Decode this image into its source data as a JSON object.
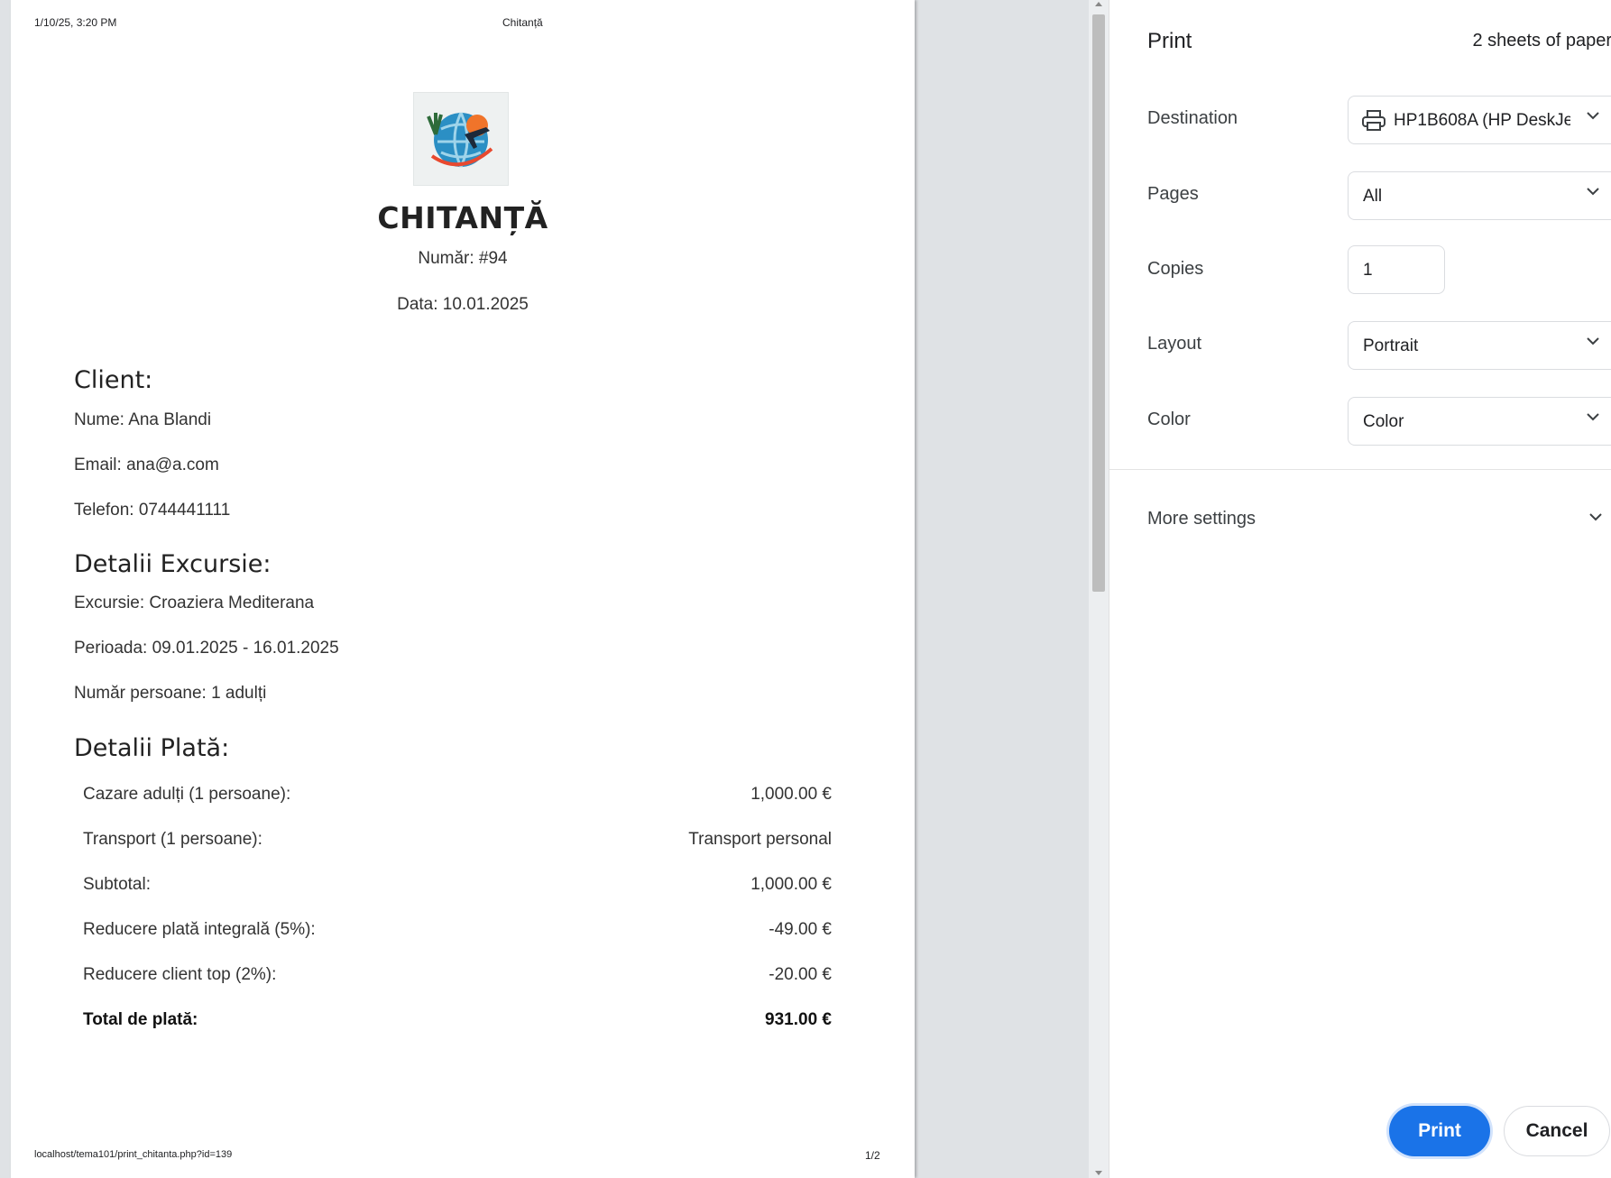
{
  "page": {
    "header_datetime": "1/10/25, 3:20 PM",
    "header_title": "Chitanță",
    "footer_url": "localhost/tema101/print_chitanta.php?id=139",
    "footer_page": "1/2"
  },
  "receipt": {
    "title": "CHITANȚĂ",
    "number": "Număr: #94",
    "date": "Data: 10.01.2025",
    "client_heading": "Client:",
    "client_name": "Nume: Ana Blandi",
    "client_email": "Email: ana@a.com",
    "client_phone": "Telefon: 0744441111",
    "trip_heading": "Detalii Excursie:",
    "trip_name": "Excursie: Croaziera Mediterana",
    "trip_period": "Perioada: 09.01.2025 - 16.01.2025",
    "trip_persons": "Număr persoane: 1 adulți",
    "payment_heading": "Detalii Plată:",
    "payment_rows": [
      {
        "label": "Cazare adulți (1 persoane):",
        "value": "1,000.00 €"
      },
      {
        "label": "Transport (1 persoane):",
        "value": "Transport personal"
      },
      {
        "label": "Subtotal:",
        "value": "1,000.00 €"
      },
      {
        "label": "Reducere plată integrală (5%):",
        "value": "-49.00 €"
      },
      {
        "label": "Reducere client top (2%):",
        "value": "-20.00 €"
      },
      {
        "label": "Total de plată:",
        "value": "931.00 €"
      }
    ]
  },
  "print_panel": {
    "title": "Print",
    "sheets": "2 sheets of paper",
    "destination_label": "Destination",
    "destination_value": "HP1B608A (HP DeskJet",
    "pages_label": "Pages",
    "pages_value": "All",
    "copies_label": "Copies",
    "copies_value": "1",
    "layout_label": "Layout",
    "layout_value": "Portrait",
    "color_label": "Color",
    "color_value": "Color",
    "more_settings": "More settings",
    "print_button": "Print",
    "cancel_button": "Cancel"
  },
  "colors": {
    "accent": "#1a73e8",
    "preview_bg": "#dfe2e5"
  }
}
